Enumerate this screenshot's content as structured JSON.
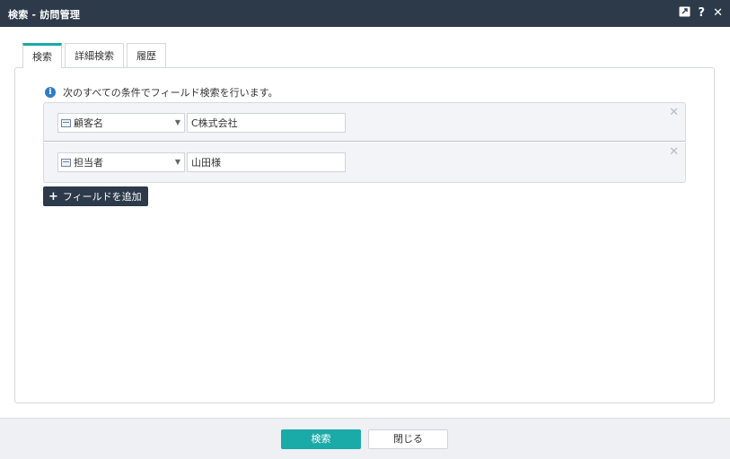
{
  "window": {
    "title": "検索 - 訪問管理",
    "icons": [
      "popout-icon",
      "help-icon",
      "close-icon"
    ],
    "help_glyph": "?",
    "close_glyph": "✕"
  },
  "tabs": [
    {
      "label": "検索",
      "active": true
    },
    {
      "label": "詳細検索",
      "active": false
    },
    {
      "label": "履歴",
      "active": false
    }
  ],
  "info_text": "次のすべての条件でフィールド検索を行います。",
  "conditions": [
    {
      "field": "顧客名",
      "value": "C株式会社"
    },
    {
      "field": "担当者",
      "value": "山田様"
    }
  ],
  "add_field_label": "フィールドを追加",
  "footer": {
    "search_label": "検索",
    "close_label": "閉じる"
  },
  "colors": {
    "titlebar": "#2c3a4a",
    "accent": "#1aaaa8",
    "info": "#2f7bc6"
  }
}
